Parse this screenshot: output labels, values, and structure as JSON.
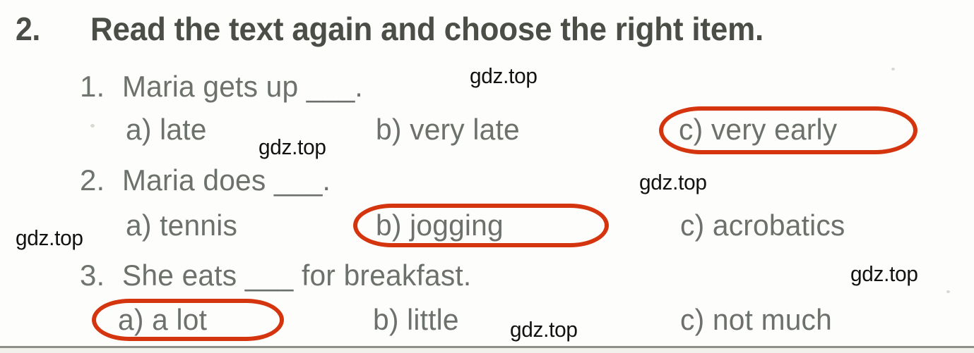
{
  "exercise": {
    "number": "2.",
    "instruction": "Read the text again and choose the right item."
  },
  "questions": [
    {
      "number": "1.",
      "prompt": "Maria gets up ___.",
      "options": [
        {
          "label": "a) late",
          "circled": false
        },
        {
          "label": "b) very late",
          "circled": false
        },
        {
          "label": "c) very early",
          "circled": true
        }
      ]
    },
    {
      "number": "2.",
      "prompt": "Maria  does ___.",
      "options": [
        {
          "label": "a) tennis",
          "circled": false
        },
        {
          "label": "b) jogging",
          "circled": true
        },
        {
          "label": "c) acrobatics",
          "circled": false
        }
      ]
    },
    {
      "number": "3.",
      "prompt": "She eats ___ for breakfast.",
      "options": [
        {
          "label": "a) a lot",
          "circled": true
        },
        {
          "label": "b) little",
          "circled": false
        },
        {
          "label": "c) not much",
          "circled": false
        }
      ]
    }
  ],
  "watermarks": [
    {
      "text": "gdz.top"
    },
    {
      "text": "gdz.top"
    },
    {
      "text": "gdz.top"
    },
    {
      "text": "gdz.top"
    },
    {
      "text": "gdz.top"
    },
    {
      "text": "gdz.top"
    }
  ],
  "colors": {
    "answer_mark": "#d5350e",
    "body_text": "#6d716c",
    "heading_text": "#4a4e47",
    "watermark": "#121212",
    "page_background": "#fdfdfb"
  }
}
